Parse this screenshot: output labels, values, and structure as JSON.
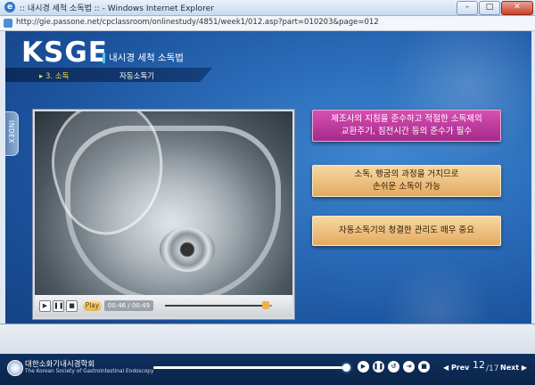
{
  "window": {
    "title": ":: 내시경 세척 소독법 :: - Windows Internet Explorer",
    "url": "http://gie.passone.net/cpclassroom/onlinestudy/4851/week1/012.asp?part=010203&page=012",
    "controls": {
      "minimize": "–",
      "maximize": "□",
      "close": "✕"
    }
  },
  "header": {
    "logo": "KSGE",
    "course_title": "내시경 세척 소독법",
    "breadcrumb_section": "▸ 3. 소독",
    "breadcrumb_topic": "자동소독기",
    "index_tab": "INDEX"
  },
  "video": {
    "play_label": "Play",
    "time": "00:46 / 00:49",
    "progress_fraction": 0.94,
    "buttons": {
      "play": "▶",
      "pause": "❚❚",
      "stop": "■"
    }
  },
  "points": [
    {
      "line1": "제조사의 지침을 준수하고 적절한 소독제의",
      "line2": "교환주기, 침전시간 등의 준수가 필수",
      "style": "magenta"
    },
    {
      "line1": "소독, 헹굼의 과정을 거치므로",
      "line2": "손쉬운 소독이 가능",
      "style": "tan"
    },
    {
      "line1": "자동소독기의 청결한 관리도 매우 중요",
      "line2": "",
      "style": "tan"
    }
  ],
  "footer": {
    "society_ko": "대한소화기내시경학회",
    "society_en": "The Korean Society of Gastrointestinal Endoscopy",
    "lesson_progress_fraction": 0.99,
    "controls": {
      "play": "▶",
      "pause": "❚❚",
      "replay": "↺",
      "skip": "⇥",
      "stop": "■"
    },
    "prev_label": "◀ Prev",
    "next_label": "Next ▶",
    "page_current": "12",
    "page_total": "/17"
  },
  "colors": {
    "stage_blue": "#2a6bb8",
    "accent_magenta": "#c43a9e",
    "accent_tan": "#e8b46a",
    "breadcrumb_highlight": "#ffd23a"
  }
}
